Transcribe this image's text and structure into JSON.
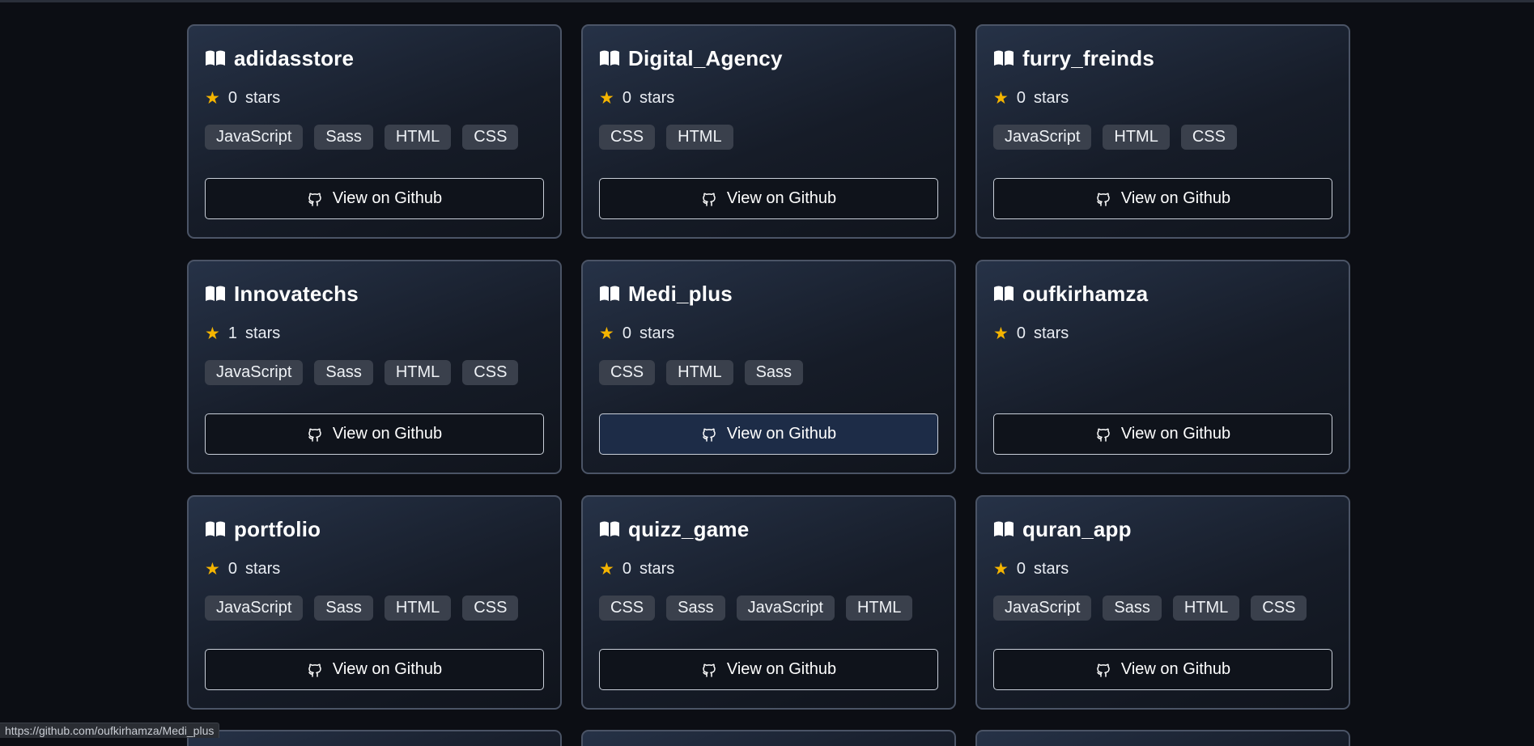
{
  "colors": {
    "background": "#0c0e14",
    "card_border": "#4b5466",
    "star": "#f4b400",
    "tag_bg": "#3a404c",
    "button_hover_bg": "#1d2c47"
  },
  "stars_suffix": "stars",
  "button_label": "View on Github",
  "repos": [
    {
      "name": "adidasstore",
      "stars": "0",
      "languages": [
        "JavaScript",
        "Sass",
        "HTML",
        "CSS"
      ]
    },
    {
      "name": "Digital_Agency",
      "stars": "0",
      "languages": [
        "CSS",
        "HTML"
      ]
    },
    {
      "name": "furry_freinds",
      "stars": "0",
      "languages": [
        "JavaScript",
        "HTML",
        "CSS"
      ]
    },
    {
      "name": "Innovatechs",
      "stars": "1",
      "languages": [
        "JavaScript",
        "Sass",
        "HTML",
        "CSS"
      ]
    },
    {
      "name": "Medi_plus",
      "stars": "0",
      "languages": [
        "CSS",
        "HTML",
        "Sass"
      ],
      "hovered": true
    },
    {
      "name": "oufkirhamza",
      "stars": "0",
      "languages": []
    },
    {
      "name": "portfolio",
      "stars": "0",
      "languages": [
        "JavaScript",
        "Sass",
        "HTML",
        "CSS"
      ]
    },
    {
      "name": "quizz_game",
      "stars": "0",
      "languages": [
        "CSS",
        "Sass",
        "JavaScript",
        "HTML"
      ]
    },
    {
      "name": "quran_app",
      "stars": "0",
      "languages": [
        "JavaScript",
        "Sass",
        "HTML",
        "CSS"
      ]
    }
  ],
  "status_bar": {
    "url": "https://github.com/oufkirhamza/Medi_plus"
  }
}
